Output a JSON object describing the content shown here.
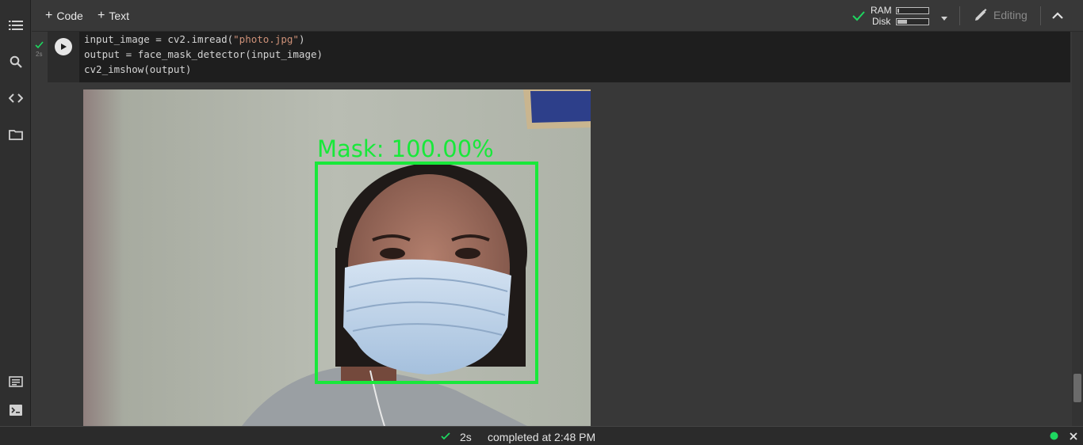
{
  "toolbar": {
    "add_code_label": "Code",
    "add_text_label": "Text",
    "ram_label": "RAM",
    "disk_label": "Disk",
    "ram_usage": 0.05,
    "disk_usage": 0.3,
    "editing_label": "Editing"
  },
  "cell": {
    "code_line_1a": "input_image = cv2.imread(",
    "code_line_1b": "\"photo.jpg\"",
    "code_line_1c": ")",
    "code_line_2": "output = face_mask_detector(input_image)",
    "code_line_3": "cv2_imshow(output)",
    "exec_time": "2s"
  },
  "output": {
    "detection_label": "Mask: 100.00%",
    "box_color": "#18e83a"
  },
  "status": {
    "duration": "2s",
    "completed_text": "completed at 2:48 PM"
  },
  "colors": {
    "accent_green": "#1ed760",
    "background": "#383838",
    "code_bg": "#1e1e1e",
    "string": "#ce9178"
  },
  "icons": [
    "table-of-contents-icon",
    "search-icon",
    "code-snippets-icon",
    "folder-icon",
    "command-palette-icon",
    "terminal-icon",
    "check-icon",
    "dropdown-icon",
    "pencil-icon",
    "chevron-up-icon",
    "play-icon",
    "status-dot-icon",
    "close-icon"
  ]
}
